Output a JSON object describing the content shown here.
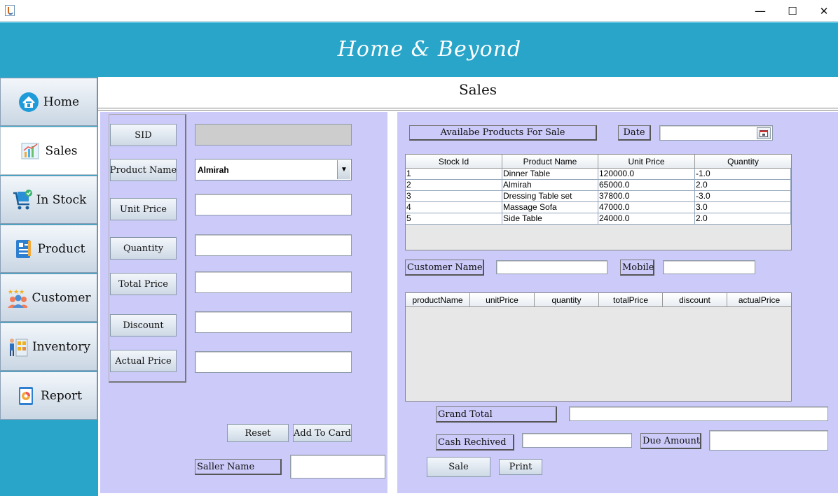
{
  "window": {
    "minimize": "—",
    "maximize": "☐",
    "close": "✕"
  },
  "header": {
    "brand": "Home & Beyond"
  },
  "sidebar": {
    "items": [
      {
        "label": "Home",
        "icon": "home-icon"
      },
      {
        "label": "Sales",
        "icon": "sales-chart-icon"
      },
      {
        "label": "In Stock",
        "icon": "cart-icon"
      },
      {
        "label": "Product",
        "icon": "product-list-icon"
      },
      {
        "label": "Customer",
        "icon": "customer-group-icon"
      },
      {
        "label": "Inventory",
        "icon": "inventory-worker-icon"
      },
      {
        "label": "Report",
        "icon": "report-icon"
      }
    ],
    "active": "Sales"
  },
  "page": {
    "title": "Sales"
  },
  "form": {
    "sid_label": "SID",
    "product_name_label": "Product Name",
    "product_name_value": "Almirah",
    "unit_price_label": "Unit Price",
    "quantity_label": "Quantity",
    "total_price_label": "Total Price",
    "discount_label": "Discount",
    "actual_price_label": "Actual Price",
    "reset_label": "Reset",
    "add_label": "Add To Card",
    "seller_label": "Saller Name"
  },
  "available": {
    "label": "Availabe Products For Sale",
    "date_label": "Date",
    "columns": [
      "Stock Id",
      "Product Name",
      "Unit Price",
      "Quantity"
    ],
    "rows": [
      [
        "1",
        "Dinner Table",
        "120000.0",
        "-1.0"
      ],
      [
        "2",
        "Almirah",
        "65000.0",
        "2.0"
      ],
      [
        "3",
        "Dressing Table set",
        "37800.0",
        "-3.0"
      ],
      [
        "4",
        "Massage Sofa",
        "47000.0",
        "3.0"
      ],
      [
        "5",
        "Side Table",
        "24000.0",
        "2.0"
      ]
    ]
  },
  "customer": {
    "name_label": "Customer Name",
    "mobile_label": "Mobile"
  },
  "cart": {
    "columns": [
      "productName",
      "unitPrice",
      "quantity",
      "totalPrice",
      "discount",
      "actualPrice"
    ]
  },
  "summary": {
    "grand_total_label": "Grand Total",
    "cash_label": "Cash Rechived",
    "due_label": "Due Amount",
    "sale_label": "Sale",
    "print_label": "Print"
  },
  "colors": {
    "header": "#28a5c8",
    "panel": "#cccaf9"
  }
}
